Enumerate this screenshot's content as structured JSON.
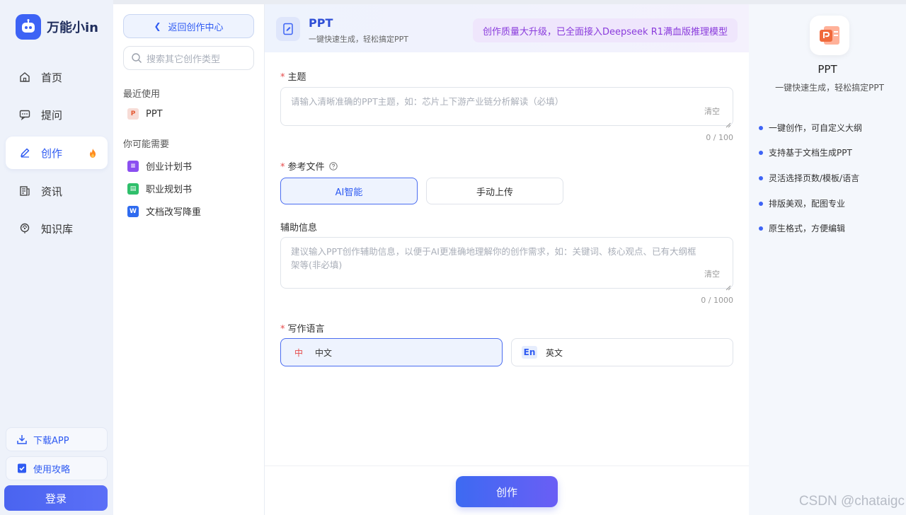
{
  "brand": {
    "name": "万能小in"
  },
  "nav": {
    "items": [
      {
        "label": "首页",
        "icon": "home-icon"
      },
      {
        "label": "提问",
        "icon": "chat-icon"
      },
      {
        "label": "创作",
        "icon": "pen-icon",
        "active": true
      },
      {
        "label": "资讯",
        "icon": "news-icon"
      },
      {
        "label": "知识库",
        "icon": "brain-icon"
      }
    ],
    "download": "下载APP",
    "guide": "使用攻略",
    "login": "登录"
  },
  "category": {
    "back": "返回创作中心",
    "search_placeholder": "搜索其它创作类型",
    "recent_title": "最近使用",
    "recent": [
      {
        "label": "PPT"
      }
    ],
    "suggest_title": "你可能需要",
    "suggest": [
      {
        "label": "创业计划书"
      },
      {
        "label": "职业规划书"
      },
      {
        "label": "文档改写降重"
      }
    ]
  },
  "main": {
    "title": "PPT",
    "subtitle": "一键快速生成，轻松搞定PPT",
    "banner": "创作质量大升级，已全面接入Deepseek R1满血版推理模型",
    "topic": {
      "label": "主题",
      "placeholder": "请输入清晰准确的PPT主题，如：芯片上下游产业链分析解读（必填）",
      "clear": "清空",
      "counter": "0 / 100"
    },
    "ref": {
      "label": "参考文件",
      "options": [
        "AI智能",
        "手动上传"
      ]
    },
    "aux": {
      "label": "辅助信息",
      "placeholder": "建议输入PPT创作辅助信息，以便于AI更准确地理解你的创作需求，如：关键词、核心观点、已有大纲框架等(非必填)",
      "clear": "清空",
      "counter": "0 / 1000"
    },
    "lang": {
      "label": "写作语言",
      "options": [
        {
          "badge": "中",
          "label": "中文"
        },
        {
          "badge": "En",
          "label": "英文"
        }
      ]
    },
    "create": "创作"
  },
  "info": {
    "title": "PPT",
    "subtitle": "一键快速生成，轻松搞定PPT",
    "features": [
      "一键创作，可自定义大纲",
      "支持基于文档生成PPT",
      "灵活选择页数/模板/语言",
      "排版美观，配图专业",
      "原生格式，方便编辑"
    ]
  },
  "watermark": "CSDN @chataigc",
  "colors": {
    "accent": "#3d63f5",
    "banner_text": "#8a3bdc",
    "required": "#e64b4b"
  }
}
